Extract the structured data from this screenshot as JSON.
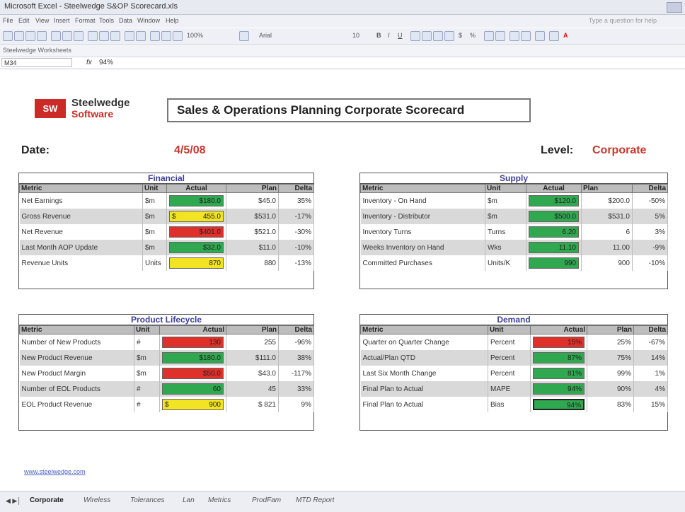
{
  "window": {
    "title": "Microsoft Excel - Steelwedge S&OP Scorecard.xls"
  },
  "menu": [
    "File",
    "Edit",
    "View",
    "Insert",
    "Format",
    "Tools",
    "Data",
    "Window",
    "Help"
  ],
  "help_placeholder": "Type a question for help",
  "toolbar": {
    "zoom": "100%",
    "font": "Arial",
    "font_size": "10"
  },
  "worksheet_bar": {
    "label": "Steelwedge Worksheets"
  },
  "formula_bar": {
    "cell": "M34",
    "fx": "fx",
    "value": "94%"
  },
  "logo": {
    "mark": "SW",
    "name1": "Steelwedge",
    "name2": "Software"
  },
  "sheet_title": "Sales & Operations Planning Corporate Scorecard",
  "date": {
    "label": "Date:",
    "value": "4/5/08"
  },
  "level": {
    "label": "Level:",
    "value": "Corporate"
  },
  "headers": [
    "Metric",
    "Unit",
    "Actual",
    "Plan",
    "Delta"
  ],
  "financial": {
    "title": "Financial",
    "rows": [
      {
        "metric": "Net Earnings",
        "unit": "$m",
        "actual": "$180.0",
        "actual_color": "green",
        "plan": "$45.0",
        "delta": "35%"
      },
      {
        "metric": "Gross Revenue",
        "unit": "$m",
        "actual_cur": "$",
        "actual": "455.0",
        "actual_color": "yellow",
        "plan": "$531.0",
        "delta": "-17%"
      },
      {
        "metric": "Net Revenue",
        "unit": "$m",
        "actual": "$401.0",
        "actual_color": "red",
        "plan": "$521.0",
        "delta": "-30%"
      },
      {
        "metric": "Last Month AOP Update",
        "unit": "$m",
        "actual": "$32.0",
        "actual_color": "green",
        "plan": "$11.0",
        "delta": "-10%"
      },
      {
        "metric": "Revenue Units",
        "unit": "Units",
        "actual": "870",
        "actual_color": "yellow",
        "plan": "880",
        "delta": "-13%"
      }
    ]
  },
  "supply": {
    "title": "Supply",
    "rows": [
      {
        "metric": "Inventory - On Hand",
        "unit": "$m",
        "actual": "$120.0",
        "actual_color": "green",
        "plan": "$200.0",
        "delta": "-50%"
      },
      {
        "metric": "Inventory - Distributor",
        "unit": "$m",
        "actual": "$500.0",
        "actual_color": "green",
        "plan": "$531.0",
        "delta": "5%"
      },
      {
        "metric": "Inventory Turns",
        "unit": "Turns",
        "actual": "6.20",
        "actual_color": "green",
        "plan": "6",
        "delta": "3%"
      },
      {
        "metric": "Weeks Inventory on Hand",
        "unit": "Wks",
        "actual": "11.10",
        "actual_color": "green",
        "plan": "11.00",
        "delta": "-9%"
      },
      {
        "metric": "Committed Purchases",
        "unit": "Units/K",
        "actual": "990",
        "actual_color": "green",
        "plan": "900",
        "delta": "-10%"
      }
    ]
  },
  "product_lifecycle": {
    "title": "Product Lifecycle",
    "rows": [
      {
        "metric": "Number of New Products",
        "unit": "#",
        "actual": "130",
        "actual_color": "red",
        "plan": "255",
        "delta": "-96%"
      },
      {
        "metric": "New Product Revenue",
        "unit": "$m",
        "actual": "$180.0",
        "actual_color": "green",
        "plan": "$111.0",
        "delta": "38%"
      },
      {
        "metric": "New Product Margin",
        "unit": "$m",
        "actual": "$50.0",
        "actual_color": "red",
        "plan": "$43.0",
        "delta": "-117%"
      },
      {
        "metric": "Number of EOL Products",
        "unit": "#",
        "actual": "60",
        "actual_color": "green",
        "plan": "45",
        "delta": "33%"
      },
      {
        "metric": "EOL Product Revenue",
        "unit": "#",
        "actual_cur": "$",
        "actual": "900",
        "actual_color": "yellow",
        "plan": "$ 821",
        "delta": "9%"
      }
    ]
  },
  "demand": {
    "title": "Demand",
    "rows": [
      {
        "metric": "Quarter on Quarter Change",
        "unit": "Percent",
        "actual": "15%",
        "actual_color": "red",
        "plan": "25%",
        "delta": "-67%"
      },
      {
        "metric": "Actual/Plan QTD",
        "unit": "Percent",
        "actual": "87%",
        "actual_color": "green",
        "plan": "75%",
        "delta": "14%"
      },
      {
        "metric": "Last Six Month Change",
        "unit": "Percent",
        "actual": "81%",
        "actual_color": "green",
        "plan": "99%",
        "delta": "1%"
      },
      {
        "metric": "Final Plan to Actual",
        "unit": "MAPE",
        "actual": "94%",
        "actual_color": "green",
        "plan": "90%",
        "delta": "4%"
      },
      {
        "metric": "Final Plan to Actual",
        "unit": "Bias",
        "actual": "94%",
        "actual_color": "green",
        "plan": "83%",
        "delta": "15%"
      }
    ]
  },
  "footer_link": "www.steelwedge.com",
  "sheet_tabs": [
    "Corporate",
    "Wireless",
    "Tolerances",
    "Lan",
    "Metrics",
    "ProdFam",
    "MTD Report"
  ],
  "colors": {
    "green": "#2fa84f",
    "red": "#e0302a",
    "yellow": "#f2e324",
    "title_blue": "#3d3f95",
    "accent_red": "#c8362f"
  }
}
